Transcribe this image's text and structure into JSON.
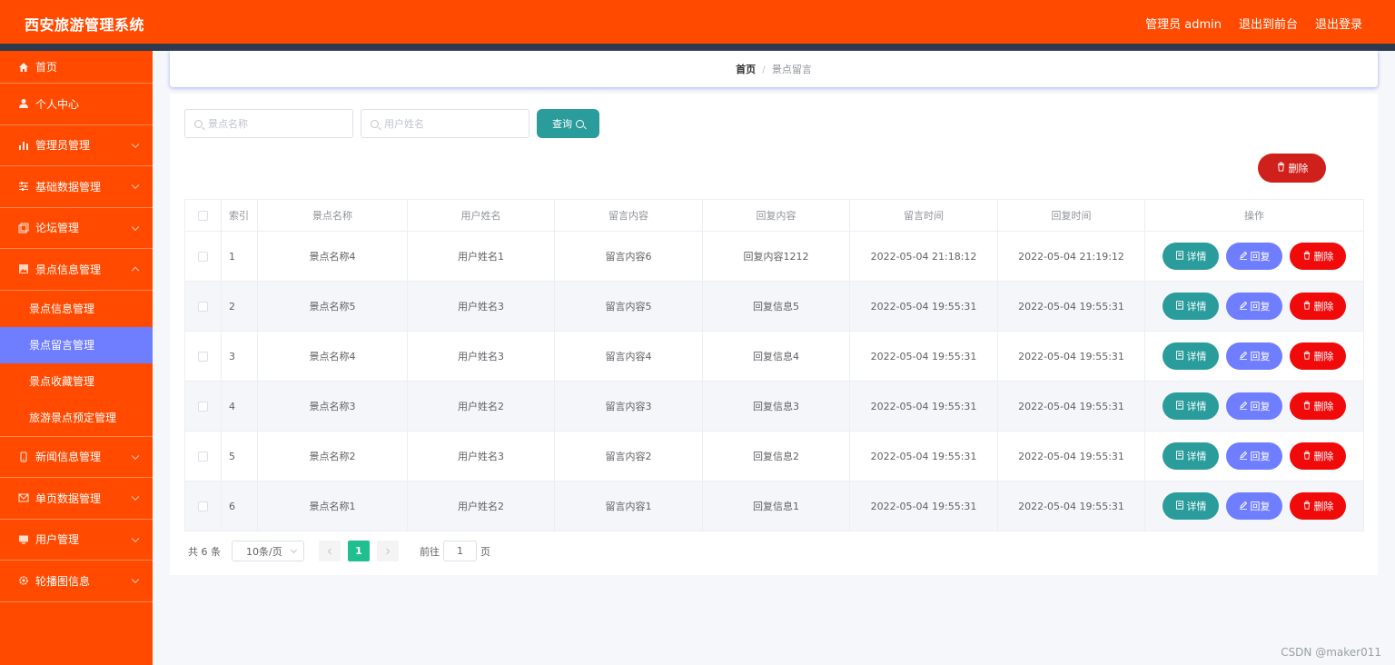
{
  "app": {
    "title": "西安旅游管理系统",
    "admin_label": "管理员 admin",
    "to_front": "退出到前台",
    "logout": "退出登录"
  },
  "sidebar": {
    "items": [
      {
        "label": "首页",
        "icon": "home-icon"
      },
      {
        "label": "个人中心",
        "icon": "user-icon"
      },
      {
        "label": "管理员管理",
        "icon": "chart-icon"
      },
      {
        "label": "基础数据管理",
        "icon": "sliders-icon"
      },
      {
        "label": "论坛管理",
        "icon": "copy-icon"
      },
      {
        "label": "景点信息管理",
        "icon": "picture-icon"
      },
      {
        "label": "新闻信息管理",
        "icon": "phone-icon"
      },
      {
        "label": "单页数据管理",
        "icon": "mail-icon"
      },
      {
        "label": "用户管理",
        "icon": "monitor-icon"
      },
      {
        "label": "轮播图信息",
        "icon": "gear-icon"
      }
    ],
    "subitems": [
      {
        "label": "景点信息管理"
      },
      {
        "label": "景点留言管理",
        "active": true
      },
      {
        "label": "景点收藏管理"
      },
      {
        "label": "旅游景点预定管理"
      }
    ]
  },
  "breadcrumb": {
    "home": "首页",
    "separator": "/",
    "current": "景点留言"
  },
  "search": {
    "spot_placeholder": "景点名称",
    "user_placeholder": "用户姓名",
    "query_label": "查询"
  },
  "bulk_delete_label": "删除",
  "table": {
    "headers": [
      "索引",
      "景点名称",
      "用户姓名",
      "留言内容",
      "回复内容",
      "留言时间",
      "回复时间",
      "操作"
    ],
    "rows": [
      {
        "index": "1",
        "spot": "景点名称4",
        "user": "用户姓名1",
        "message": "留言内容6",
        "reply": "回复内容1212",
        "msg_time": "2022-05-04 21:18:12",
        "reply_time": "2022-05-04 21:19:12"
      },
      {
        "index": "2",
        "spot": "景点名称5",
        "user": "用户姓名3",
        "message": "留言内容5",
        "reply": "回复信息5",
        "msg_time": "2022-05-04 19:55:31",
        "reply_time": "2022-05-04 19:55:31"
      },
      {
        "index": "3",
        "spot": "景点名称4",
        "user": "用户姓名3",
        "message": "留言内容4",
        "reply": "回复信息4",
        "msg_time": "2022-05-04 19:55:31",
        "reply_time": "2022-05-04 19:55:31"
      },
      {
        "index": "4",
        "spot": "景点名称3",
        "user": "用户姓名2",
        "message": "留言内容3",
        "reply": "回复信息3",
        "msg_time": "2022-05-04 19:55:31",
        "reply_time": "2022-05-04 19:55:31"
      },
      {
        "index": "5",
        "spot": "景点名称2",
        "user": "用户姓名3",
        "message": "留言内容2",
        "reply": "回复信息2",
        "msg_time": "2022-05-04 19:55:31",
        "reply_time": "2022-05-04 19:55:31"
      },
      {
        "index": "6",
        "spot": "景点名称1",
        "user": "用户姓名2",
        "message": "留言内容1",
        "reply": "回复信息1",
        "msg_time": "2022-05-04 19:55:31",
        "reply_time": "2022-05-04 19:55:31"
      }
    ],
    "actions": {
      "detail": "详情",
      "reply": "回复",
      "delete": "删除"
    }
  },
  "pagination": {
    "total": "共 6 条",
    "page_size": "10条/页",
    "current_page": "1",
    "goto_prefix": "前往",
    "goto_value": "1",
    "goto_suffix": "页"
  },
  "watermark": "CSDN @maker011",
  "colors": {
    "brand": "#ff4a00",
    "active": "#6f7dff",
    "teal": "#2a9c9c",
    "danger": "#f00a0a",
    "page_active": "#1fbf8f"
  }
}
